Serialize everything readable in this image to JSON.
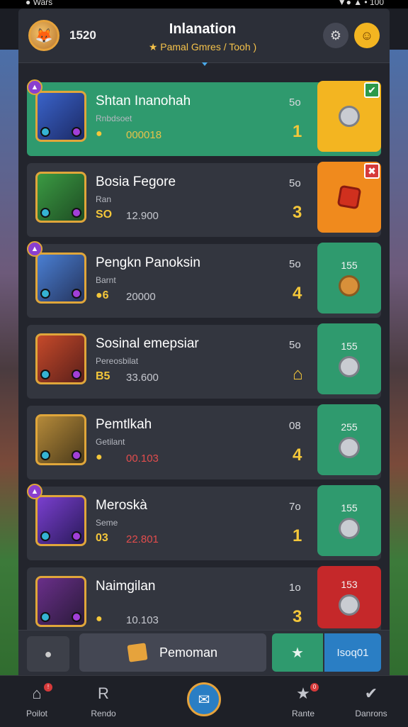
{
  "statusbar": {
    "left": "● Wars",
    "right": "▼● ▲ • 100"
  },
  "header": {
    "coins": "1520",
    "title": "Inlanation",
    "subtitle": "★ Pamal Gmres / Tooh )",
    "avatar_icon": "avatar-fox",
    "settings_icon": "gear-icon",
    "profile_icon": "smile-icon"
  },
  "rows": [
    {
      "name": "Shtan Inanohah",
      "sub": "Rnbdsoet",
      "currency": "●",
      "value": "000018",
      "points": "5o",
      "rank": "1",
      "action_num": "",
      "action_color": "yellow",
      "corner": "✔"
    },
    {
      "name": "Bosia Fegore",
      "sub": "Ran",
      "currency": "SO",
      "value": "12.900",
      "points": "5o",
      "rank": "3",
      "action_num": "",
      "action_color": "orange",
      "corner": "✖"
    },
    {
      "name": "Pengkn Panoksin",
      "sub": "Barnt",
      "currency": "●6",
      "value": "20000",
      "points": "5o",
      "rank": "4",
      "action_num": "155",
      "action_color": "green",
      "corner": ""
    },
    {
      "name": "Sosinal emepsiar",
      "sub": "Pereosbilat",
      "currency": "B5",
      "value": "33.600",
      "points": "5o",
      "rank": "⌂",
      "action_num": "155",
      "action_color": "green",
      "corner": ""
    },
    {
      "name": "Pemtlkah",
      "sub": "Getilant",
      "currency": "●",
      "value": "00.103",
      "points": "08",
      "rank": "4",
      "action_num": "255",
      "action_color": "green",
      "corner": ""
    },
    {
      "name": "Meroskà",
      "sub": "Seme",
      "currency": "03",
      "value": "22.801",
      "points": "7o",
      "rank": "1",
      "action_num": "155",
      "action_color": "green",
      "corner": ""
    },
    {
      "name": "Naimgilan",
      "sub": "",
      "currency": "●",
      "value": "10.103",
      "points": "1o",
      "rank": "3",
      "action_num": "153",
      "action_color": "red",
      "corner": ""
    }
  ],
  "actionbar": {
    "main_label": "Pemoman",
    "right_label": "Isoq01"
  },
  "nav": [
    {
      "label": "Poilot",
      "badge": "!"
    },
    {
      "label": "Rendo",
      "badge": ""
    },
    {
      "label": "Rante",
      "badge": "0"
    },
    {
      "label": "Danrons",
      "badge": ""
    }
  ]
}
